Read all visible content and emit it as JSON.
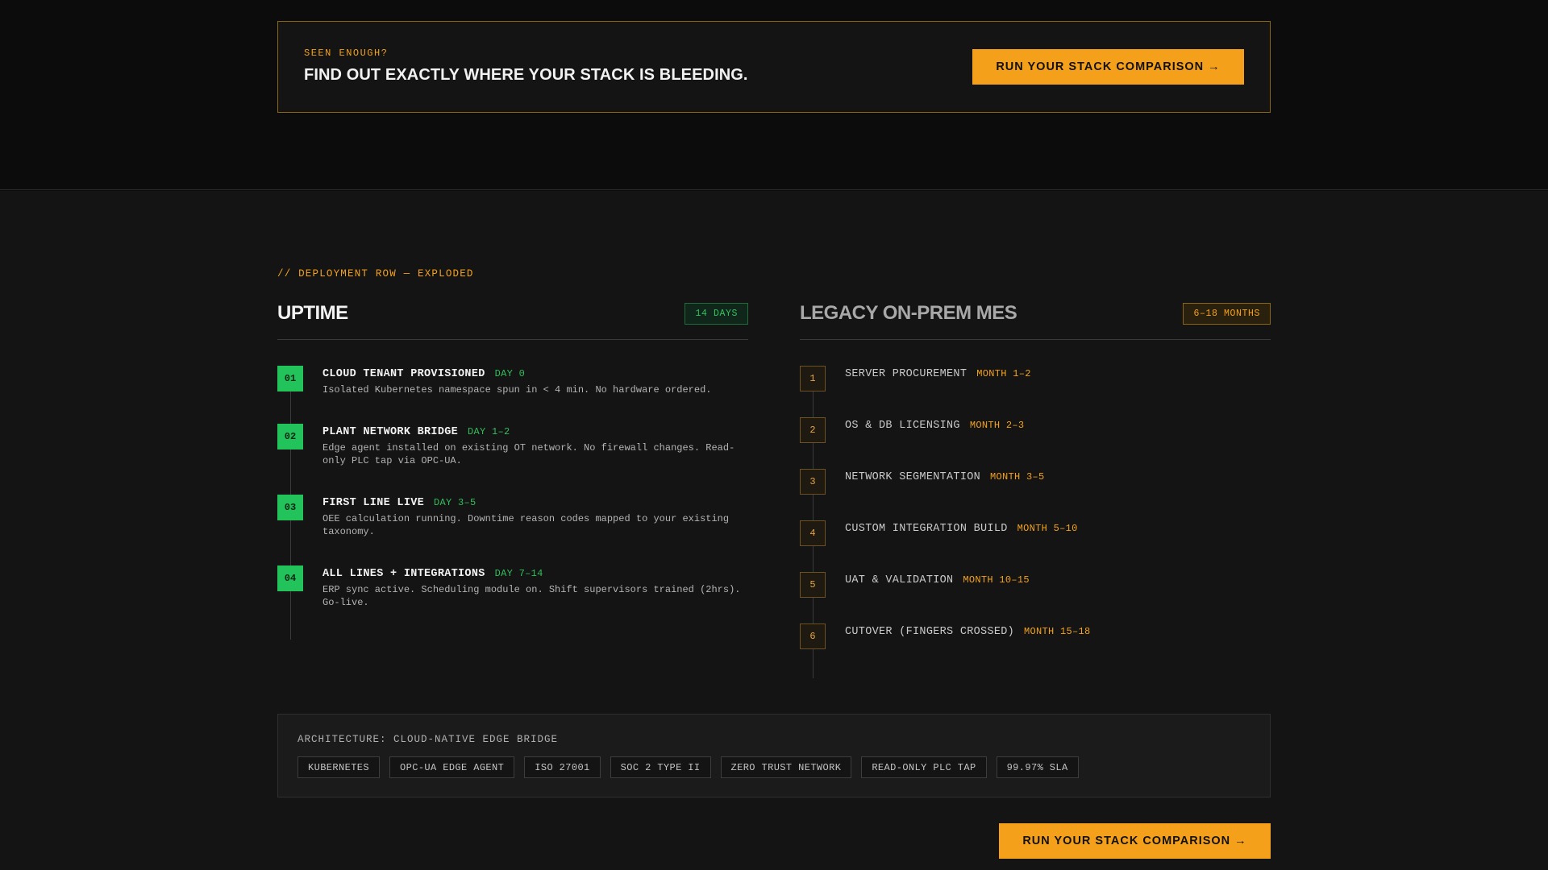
{
  "cta_top": {
    "eyebrow": "SEEN ENOUGH?",
    "headline": "FIND OUT EXACTLY WHERE YOUR STACK IS BLEEDING.",
    "button_label": "RUN YOUR STACK COMPARISON →"
  },
  "section": {
    "eyebrow": "// DEPLOYMENT ROW — EXPLODED"
  },
  "uptime": {
    "title": "UPTIME",
    "badge": "14 DAYS",
    "steps": [
      {
        "num": "01",
        "name": "CLOUD TENANT PROVISIONED",
        "time": "DAY 0",
        "desc": "Isolated Kubernetes namespace spun in < 4 min. No hardware ordered."
      },
      {
        "num": "02",
        "name": "PLANT NETWORK BRIDGE",
        "time": "DAY 1–2",
        "desc": "Edge agent installed on existing OT network. No firewall changes. Read-only PLC tap via OPC-UA."
      },
      {
        "num": "03",
        "name": "FIRST LINE LIVE",
        "time": "DAY 3–5",
        "desc": "OEE calculation running. Downtime reason codes mapped to your existing taxonomy."
      },
      {
        "num": "04",
        "name": "ALL LINES + INTEGRATIONS",
        "time": "DAY 7–14",
        "desc": "ERP sync active. Scheduling module on. Shift supervisors trained (2hrs). Go-live."
      }
    ]
  },
  "legacy": {
    "title": "LEGACY ON-PREM MES",
    "badge": "6–18 MONTHS",
    "steps": [
      {
        "num": "1",
        "name": "SERVER PROCUREMENT",
        "time": "MONTH 1–2"
      },
      {
        "num": "2",
        "name": "OS & DB LICENSING",
        "time": "MONTH 2–3"
      },
      {
        "num": "3",
        "name": "NETWORK SEGMENTATION",
        "time": "MONTH 3–5"
      },
      {
        "num": "4",
        "name": "CUSTOM INTEGRATION BUILD",
        "time": "MONTH 5–10"
      },
      {
        "num": "5",
        "name": "UAT & VALIDATION",
        "time": "MONTH 10–15"
      },
      {
        "num": "6",
        "name": "CUTOVER (FINGERS CROSSED)",
        "time": "MONTH 15–18"
      }
    ]
  },
  "architecture": {
    "label": "ARCHITECTURE: CLOUD-NATIVE EDGE BRIDGE",
    "chips": [
      "KUBERNETES",
      "OPC-UA EDGE AGENT",
      "ISO 27001",
      "SOC 2 TYPE II",
      "ZERO TRUST NETWORK",
      "READ-ONLY PLC TAP",
      "99.97% SLA"
    ]
  },
  "cta_bottom": {
    "button_label": "RUN YOUR STACK COMPARISON →"
  },
  "colors": {
    "accent": "#f5a01a",
    "success": "#22c35a",
    "background": "#141414"
  }
}
